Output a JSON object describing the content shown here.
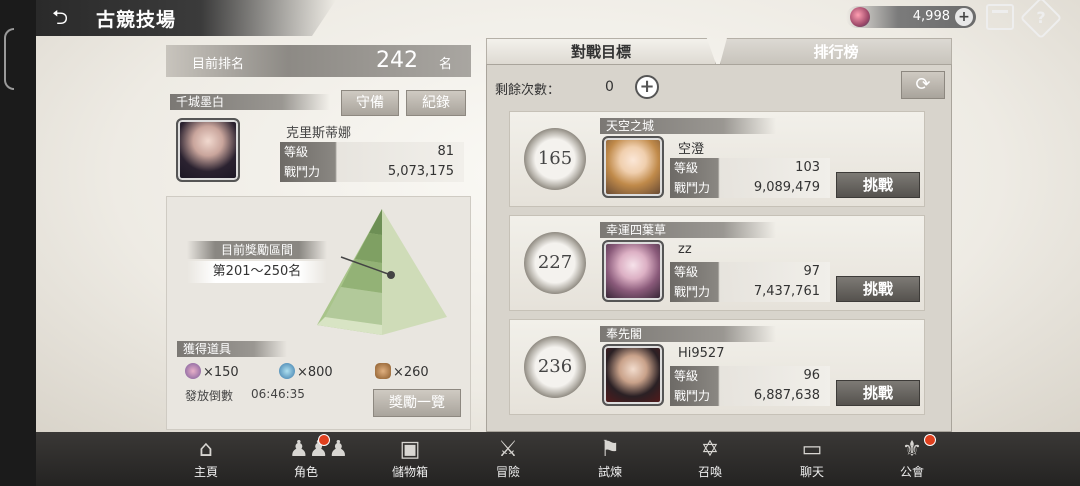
{
  "header": {
    "title": "古競技場",
    "back_icon": "back-arrow-icon",
    "currency_amount": "4,998",
    "currency_icon": "gem-icon"
  },
  "my_status": {
    "rank_label": "目前排名",
    "rank_value": "242",
    "rank_unit": "名",
    "guild_name": "千城墨白",
    "defend_label": "守備",
    "record_label": "紀錄",
    "player_name": "克里斯蒂娜",
    "level_label": "等級",
    "level_value": "81",
    "power_label": "戰鬥力",
    "power_value": "5,073,175"
  },
  "reward": {
    "bracket_label": "目前獎勵區間",
    "bracket_range": "第201～250名",
    "obtain_label": "獲得道具",
    "items": [
      {
        "icon": "crystal-icon",
        "amount": "×150"
      },
      {
        "icon": "medal-icon",
        "amount": "×800"
      },
      {
        "icon": "coin-pile-icon",
        "amount": "×260"
      }
    ],
    "countdown_label": "發放倒數",
    "countdown_value": "06:46:35",
    "list_button": "獎勵一覽"
  },
  "tabs": {
    "opponents": "對戰目標",
    "ranking": "排行榜"
  },
  "remaining": {
    "label": "剩餘次數：",
    "value": "0"
  },
  "opponents": [
    {
      "rank": "165",
      "guild": "天空之城",
      "name": "空澄",
      "level_label": "等級",
      "level": "103",
      "power_label": "戰鬥力",
      "power": "9,089,479",
      "button": "挑戰"
    },
    {
      "rank": "227",
      "guild": "幸運四葉草",
      "name": "zz",
      "level_label": "等級",
      "level": "97",
      "power_label": "戰鬥力",
      "power": "7,437,761",
      "button": "挑戰"
    },
    {
      "rank": "236",
      "guild": "奉先閣",
      "name": "Hi9527",
      "level_label": "等級",
      "level": "96",
      "power_label": "戰鬥力",
      "power": "6,887,638",
      "button": "挑戰"
    }
  ],
  "nav": [
    {
      "label": "主頁",
      "icon": "home-icon",
      "badge": false
    },
    {
      "label": "角色",
      "icon": "characters-icon",
      "badge": true
    },
    {
      "label": "儲物箱",
      "icon": "chest-icon",
      "badge": false
    },
    {
      "label": "冒險",
      "icon": "crossed-swords-icon",
      "badge": false
    },
    {
      "label": "試煉",
      "icon": "flag-icon",
      "badge": false
    },
    {
      "label": "召喚",
      "icon": "summon-circle-icon",
      "badge": false
    },
    {
      "label": "聊天",
      "icon": "chat-icon",
      "badge": false
    },
    {
      "label": "公會",
      "icon": "guild-crest-icon",
      "badge": true
    }
  ]
}
